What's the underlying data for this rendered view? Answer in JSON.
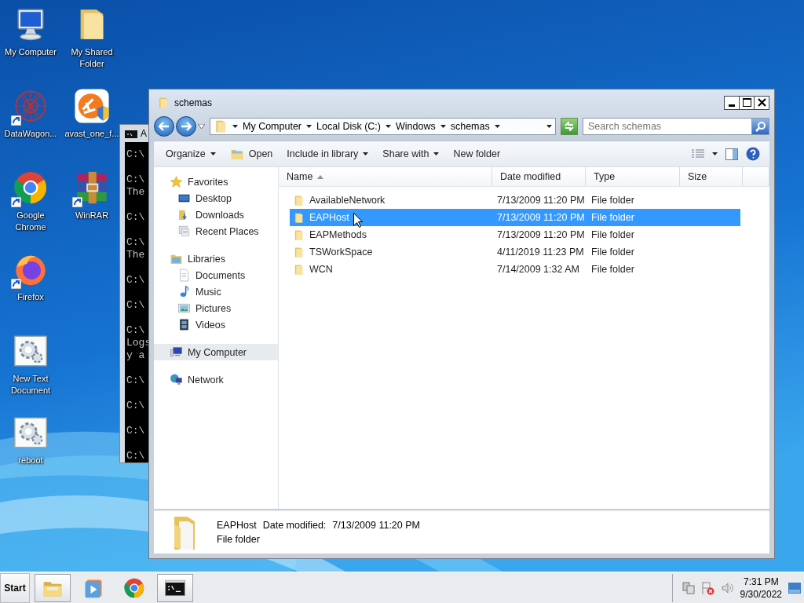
{
  "desktop_icons": [
    {
      "label": "My Computer",
      "kind": "computer",
      "shortcut": false
    },
    {
      "label": "My Shared Folder",
      "kind": "folder",
      "shortcut": false
    },
    {
      "label": "DataWagon...",
      "kind": "web",
      "shortcut": true
    },
    {
      "label": "avast_one_f...",
      "kind": "avast",
      "shortcut": false
    },
    {
      "label": "Google Chrome",
      "kind": "chrome",
      "shortcut": true
    },
    {
      "label": "WinRAR",
      "kind": "winrar",
      "shortcut": true
    },
    {
      "label": "Firefox",
      "kind": "firefox",
      "shortcut": true
    },
    {
      "label": "New Text Document",
      "kind": "gears",
      "shortcut": false
    },
    {
      "label": "reboot",
      "kind": "gears",
      "shortcut": false
    }
  ],
  "console_window": {
    "title": "A",
    "blocks": [
      [
        "C:\\"
      ],
      [
        "C:\\",
        "The"
      ],
      [
        "C:\\"
      ],
      [
        "C:\\",
        "The"
      ],
      [
        "C:\\"
      ],
      [
        "C:\\"
      ],
      [
        "C:\\",
        "Logs",
        "y a"
      ],
      [
        "C:\\"
      ],
      [
        "C:\\"
      ],
      [
        "C:\\"
      ],
      [
        "C:\\"
      ]
    ]
  },
  "explorer": {
    "title": "schemas",
    "breadcrumb": [
      "My Computer",
      "Local Disk (C:)",
      "Windows",
      "schemas"
    ],
    "search": {
      "placeholder": "Search schemas"
    },
    "toolbar": [
      {
        "label": "Organize",
        "kind": "menu",
        "dropdown": true
      },
      {
        "label": "Open",
        "kind": "open",
        "dropdown": false
      },
      {
        "label": "Include in library",
        "kind": "menu",
        "dropdown": true
      },
      {
        "label": "Share with",
        "kind": "menu",
        "dropdown": true
      },
      {
        "label": "New folder",
        "kind": "menu",
        "dropdown": false
      }
    ],
    "nav": [
      {
        "label": "Favorites",
        "kind": "star",
        "selected": false,
        "children": [
          {
            "label": "Desktop",
            "kind": "desktop",
            "selected": false
          },
          {
            "label": "Downloads",
            "kind": "downloads",
            "selected": false
          },
          {
            "label": "Recent Places",
            "kind": "recent",
            "selected": false
          }
        ]
      },
      {
        "label": "Libraries",
        "kind": "library",
        "selected": false,
        "children": [
          {
            "label": "Documents",
            "kind": "document",
            "selected": false
          },
          {
            "label": "Music",
            "kind": "music",
            "selected": false
          },
          {
            "label": "Pictures",
            "kind": "pictures",
            "selected": false
          },
          {
            "label": "Videos",
            "kind": "videos",
            "selected": false
          }
        ]
      },
      {
        "label": "My Computer",
        "kind": "mycomputer",
        "selected": true
      },
      {
        "label": "Network",
        "kind": "network",
        "selected": false
      }
    ],
    "columns": [
      {
        "label": "Name",
        "sorted": true
      },
      {
        "label": "Date modified",
        "sorted": false
      },
      {
        "label": "Type",
        "sorted": false
      },
      {
        "label": "Size",
        "sorted": false
      }
    ],
    "rows": [
      {
        "name": "AvailableNetwork",
        "date": "7/13/2009 11:20 PM",
        "type": "File folder",
        "selected": false
      },
      {
        "name": "EAPHost",
        "date": "7/13/2009 11:20 PM",
        "type": "File folder",
        "selected": true
      },
      {
        "name": "EAPMethods",
        "date": "7/13/2009 11:20 PM",
        "type": "File folder",
        "selected": false
      },
      {
        "name": "TSWorkSpace",
        "date": "4/11/2019 11:23 PM",
        "type": "File folder",
        "selected": false
      },
      {
        "name": "WCN",
        "date": "7/14/2009 1:32 AM",
        "type": "File folder",
        "selected": false
      }
    ],
    "details": {
      "name": "EAPHost",
      "date_label": "Date modified:",
      "date": "7/13/2009 11:20 PM",
      "type": "File folder"
    }
  },
  "taskbar": {
    "start": "Start",
    "apps": [
      {
        "kind": "explorer",
        "running": true
      },
      {
        "kind": "media",
        "running": false
      },
      {
        "kind": "chrome",
        "running": false
      },
      {
        "kind": "console",
        "running": true
      }
    ],
    "clock": {
      "time": "7:31 PM",
      "date": "9/30/2022"
    }
  }
}
